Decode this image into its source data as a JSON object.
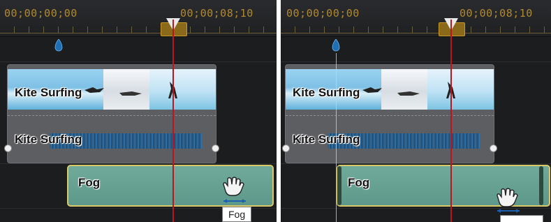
{
  "panels": [
    {
      "ruler": {
        "start_tc": "00;00;00;00",
        "mid_tc": "00;00;08;10"
      },
      "video_clip": {
        "label": "Kite Surfing"
      },
      "audio_clip": {
        "label": "Kite Surfing"
      },
      "effect_clip": {
        "label": "Fog"
      },
      "tooltip": {
        "text": "Fog"
      }
    },
    {
      "ruler": {
        "start_tc": "00;00;00;00",
        "mid_tc": "00;00;08;10"
      },
      "video_clip": {
        "label": "Kite Surfing"
      },
      "audio_clip": {
        "label": "Kite Surfing"
      },
      "effect_clip": {
        "label": "Fog"
      }
    }
  ],
  "colors": {
    "timecode": "#b08a2e",
    "playhead": "#c0141c",
    "effect_clip": "#6aa596",
    "effect_border": "#d9c86a",
    "marker": "#1f6fb5"
  },
  "icons": [
    "timeline-marker-icon",
    "playhead-icon",
    "hand-resize-cursor-icon"
  ]
}
